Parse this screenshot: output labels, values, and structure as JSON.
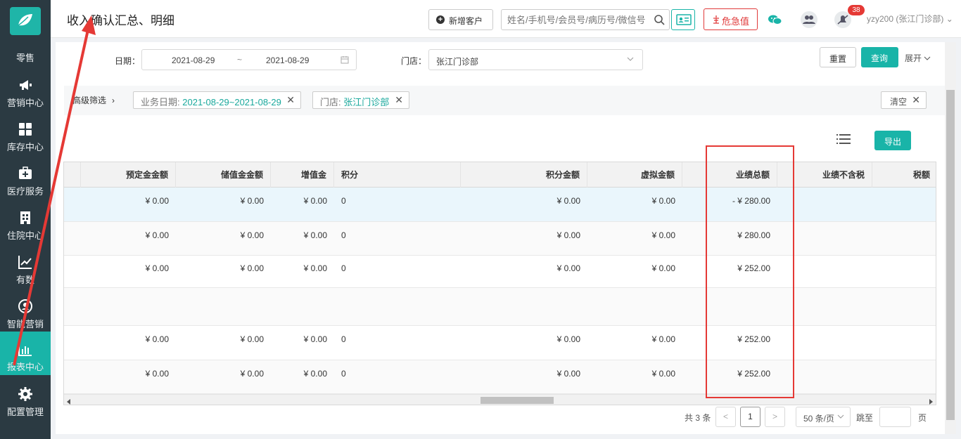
{
  "sidebar": {
    "items": [
      {
        "label": "零售",
        "icon": "retail-icon"
      },
      {
        "label": "营销中心",
        "icon": "megaphone-icon"
      },
      {
        "label": "库存中心",
        "icon": "grid-icon"
      },
      {
        "label": "医疗服务",
        "icon": "medical-kit-icon"
      },
      {
        "label": "住院中心",
        "icon": "hospital-icon"
      },
      {
        "label": "有数",
        "icon": "trend-chart-icon"
      },
      {
        "label": "智能营销",
        "icon": "smart-marketing-icon"
      },
      {
        "label": "报表中心",
        "icon": "bar-chart-icon",
        "active": true
      },
      {
        "label": "配置管理",
        "icon": "gear-icon"
      }
    ]
  },
  "header": {
    "title": "收入确认汇总、明细",
    "new_customer": "新增客户",
    "search_placeholder": "姓名/手机号/会员号/病历号/微信号",
    "danger_value": "危急值",
    "notification_count": "38",
    "user": "yzy200 (张江门诊部)"
  },
  "filters": {
    "date_label": "日期：",
    "date_start": "2021-08-29",
    "date_sep": "~",
    "date_end": "2021-08-29",
    "store_label": "门店：",
    "store_value": "张江门诊部",
    "reset": "重置",
    "query": "查询",
    "expand": "展开"
  },
  "advanced": {
    "label": "高级筛选",
    "tags": [
      {
        "key": "业务日期:",
        "value": "2021-08-29~2021-08-29"
      },
      {
        "key": "门店:",
        "value": "张江门诊部"
      }
    ],
    "clear": "清空"
  },
  "toolbar": {
    "export": "导出"
  },
  "table": {
    "columns": [
      "预定金金额",
      "储值金金额",
      "增值金",
      "积分",
      "积分金额",
      "虚拟金额",
      "业绩总额",
      "业绩不含税",
      "税额"
    ],
    "rows": [
      [
        "¥ 0.00",
        "¥ 0.00",
        "¥ 0.00",
        "0",
        "¥ 0.00",
        "¥ 0.00",
        "- ¥ 280.00",
        "",
        ""
      ],
      [
        "¥ 0.00",
        "¥ 0.00",
        "¥ 0.00",
        "0",
        "¥ 0.00",
        "¥ 0.00",
        "¥ 280.00",
        "",
        ""
      ],
      [
        "¥ 0.00",
        "¥ 0.00",
        "¥ 0.00",
        "0",
        "¥ 0.00",
        "¥ 0.00",
        "¥ 252.00",
        "",
        ""
      ],
      [
        "",
        "",
        "",
        "",
        "",
        "",
        "",
        "",
        ""
      ],
      [
        "¥ 0.00",
        "¥ 0.00",
        "¥ 0.00",
        "0",
        "¥ 0.00",
        "¥ 0.00",
        "¥ 252.00",
        "",
        ""
      ],
      [
        "¥ 0.00",
        "¥ 0.00",
        "¥ 0.00",
        "0",
        "¥ 0.00",
        "¥ 0.00",
        "¥ 252.00",
        "",
        ""
      ]
    ]
  },
  "pagination": {
    "total": "共 3 条",
    "prev": "<",
    "current": "1",
    "next": ">",
    "page_size": "50 条/页",
    "goto": "跳至",
    "page_suffix": "页"
  },
  "colors": {
    "accent": "#19b4a8",
    "sidebar": "#2b3a42",
    "annotation": "#e53935"
  }
}
